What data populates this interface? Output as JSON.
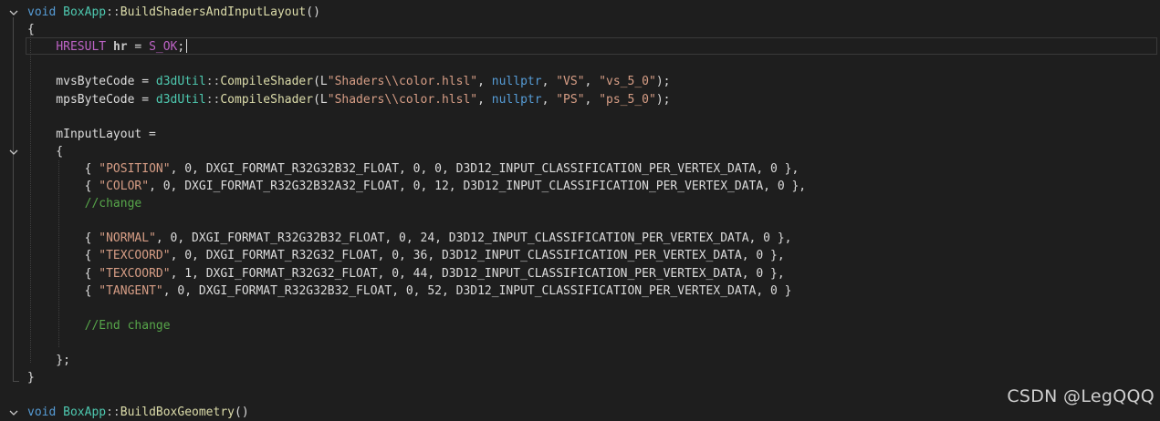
{
  "colors": {
    "background": "#1e1e1e",
    "keyword": "#569cd6",
    "type": "#4ec9b0",
    "function": "#dcdcaa",
    "string": "#d69d85",
    "comment": "#57a64a",
    "plain": "#dcdcdc"
  },
  "editor": {
    "lines": [
      {
        "fold": "chevron-down-icon",
        "tokens": [
          [
            "kw",
            "void "
          ],
          [
            "ty",
            "BoxApp"
          ],
          [
            "op",
            "::"
          ],
          [
            "fn",
            "BuildShadersAndInputLayout"
          ],
          [
            "pl",
            "()"
          ]
        ]
      },
      {
        "tokens": [
          [
            "pl",
            "{"
          ]
        ]
      },
      {
        "tokens": [
          [
            "pl",
            "    "
          ],
          [
            "mac",
            "HRESULT "
          ],
          [
            "id",
            "hr"
          ],
          [
            "pl",
            " = "
          ],
          [
            "mac",
            "S_OK"
          ],
          [
            "pl",
            ";"
          ]
        ]
      },
      {
        "tokens": []
      },
      {
        "tokens": [
          [
            "pl",
            "    mvsByteCode = "
          ],
          [
            "ty",
            "d3dUtil"
          ],
          [
            "op",
            "::"
          ],
          [
            "fn",
            "CompileShader"
          ],
          [
            "pl",
            "(L"
          ],
          [
            "st",
            "\"Shaders\\\\color.hlsl\""
          ],
          [
            "pl",
            ", "
          ],
          [
            "kw",
            "nullptr"
          ],
          [
            "pl",
            ", "
          ],
          [
            "st",
            "\"VS\""
          ],
          [
            "pl",
            ", "
          ],
          [
            "st",
            "\"vs_5_0\""
          ],
          [
            "pl",
            ");"
          ]
        ]
      },
      {
        "tokens": [
          [
            "pl",
            "    mpsByteCode = "
          ],
          [
            "ty",
            "d3dUtil"
          ],
          [
            "op",
            "::"
          ],
          [
            "fn",
            "CompileShader"
          ],
          [
            "pl",
            "(L"
          ],
          [
            "st",
            "\"Shaders\\\\color.hlsl\""
          ],
          [
            "pl",
            ", "
          ],
          [
            "kw",
            "nullptr"
          ],
          [
            "pl",
            ", "
          ],
          [
            "st",
            "\"PS\""
          ],
          [
            "pl",
            ", "
          ],
          [
            "st",
            "\"ps_5_0\""
          ],
          [
            "pl",
            ");"
          ]
        ]
      },
      {
        "tokens": []
      },
      {
        "tokens": [
          [
            "pl",
            "    mInputLayout ="
          ]
        ]
      },
      {
        "fold": "chevron-down-icon",
        "tokens": [
          [
            "pl",
            "    {"
          ]
        ]
      },
      {
        "tokens": [
          [
            "pl",
            "        { "
          ],
          [
            "st",
            "\"POSITION\""
          ],
          [
            "pl",
            ", 0, DXGI_FORMAT_R32G32B32_FLOAT, 0, 0, D3D12_INPUT_CLASSIFICATION_PER_VERTEX_DATA, 0 },"
          ]
        ]
      },
      {
        "tokens": [
          [
            "pl",
            "        { "
          ],
          [
            "st",
            "\"COLOR\""
          ],
          [
            "pl",
            ", 0, DXGI_FORMAT_R32G32B32A32_FLOAT, 0, 12, D3D12_INPUT_CLASSIFICATION_PER_VERTEX_DATA, 0 },"
          ]
        ]
      },
      {
        "tokens": [
          [
            "pl",
            "        "
          ],
          [
            "cm",
            "//change"
          ]
        ]
      },
      {
        "tokens": []
      },
      {
        "tokens": [
          [
            "pl",
            "        { "
          ],
          [
            "st",
            "\"NORMAL\""
          ],
          [
            "pl",
            ", 0, DXGI_FORMAT_R32G32B32_FLOAT, 0, 24, D3D12_INPUT_CLASSIFICATION_PER_VERTEX_DATA, 0 },"
          ]
        ]
      },
      {
        "tokens": [
          [
            "pl",
            "        { "
          ],
          [
            "st",
            "\"TEXCOORD\""
          ],
          [
            "pl",
            ", 0, DXGI_FORMAT_R32G32_FLOAT, 0, 36, D3D12_INPUT_CLASSIFICATION_PER_VERTEX_DATA, 0 },"
          ]
        ]
      },
      {
        "tokens": [
          [
            "pl",
            "        { "
          ],
          [
            "st",
            "\"TEXCOORD\""
          ],
          [
            "pl",
            ", 1, DXGI_FORMAT_R32G32_FLOAT, 0, 44, D3D12_INPUT_CLASSIFICATION_PER_VERTEX_DATA, 0 },"
          ]
        ]
      },
      {
        "tokens": [
          [
            "pl",
            "        { "
          ],
          [
            "st",
            "\"TANGENT\""
          ],
          [
            "pl",
            ", 0, DXGI_FORMAT_R32G32B32_FLOAT, 0, 52, D3D12_INPUT_CLASSIFICATION_PER_VERTEX_DATA, 0 }"
          ]
        ]
      },
      {
        "tokens": []
      },
      {
        "tokens": [
          [
            "pl",
            "        "
          ],
          [
            "cm",
            "//End change"
          ]
        ]
      },
      {
        "tokens": []
      },
      {
        "tokens": [
          [
            "pl",
            "    };"
          ]
        ]
      },
      {
        "tokens": [
          [
            "pl",
            "}"
          ]
        ]
      },
      {
        "tokens": []
      },
      {
        "fold": "chevron-down-icon",
        "tokens": [
          [
            "kw",
            "void "
          ],
          [
            "ty",
            "BoxApp"
          ],
          [
            "op",
            "::"
          ],
          [
            "fn",
            "BuildBoxGeometry"
          ],
          [
            "pl",
            "()"
          ]
        ]
      }
    ]
  },
  "watermark": "CSDN @LegQQQ"
}
